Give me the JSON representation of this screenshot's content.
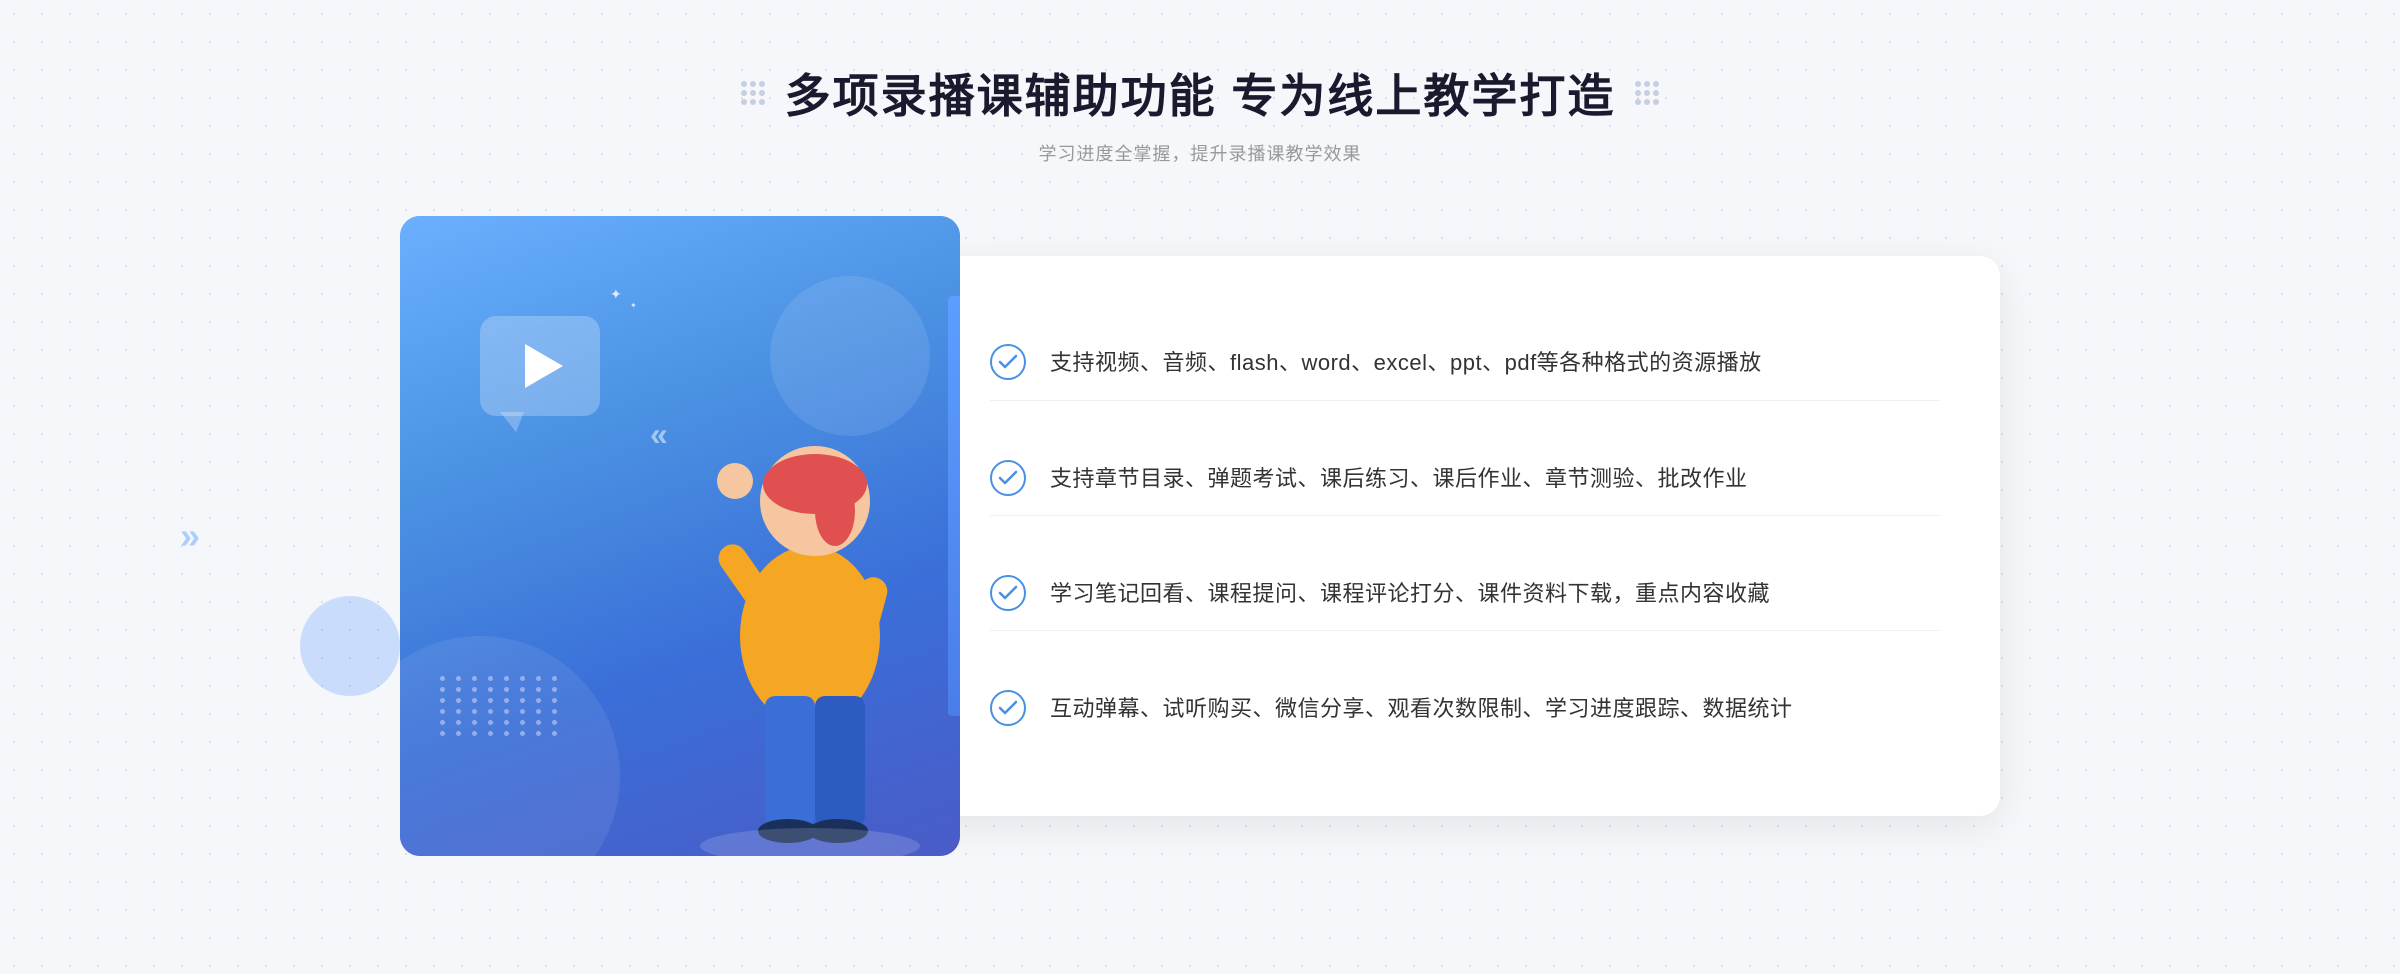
{
  "header": {
    "title": "多项录播课辅助功能 专为线上教学打造",
    "subtitle": "学习进度全掌握，提升录播课教学效果",
    "decor_left_label": "decorative-dots-left",
    "decor_right_label": "decorative-dots-right"
  },
  "features": [
    {
      "id": 1,
      "text": "支持视频、音频、flash、word、excel、ppt、pdf等各种格式的资源播放"
    },
    {
      "id": 2,
      "text": "支持章节目录、弹题考试、课后练习、课后作业、章节测验、批改作业"
    },
    {
      "id": 3,
      "text": "学习笔记回看、课程提问、课程评论打分、课件资料下载，重点内容收藏"
    },
    {
      "id": 4,
      "text": "互动弹幕、试听购买、微信分享、观看次数限制、学习进度跟踪、数据统计"
    }
  ],
  "colors": {
    "primary_blue": "#4a90e2",
    "light_blue": "#6ab0ff",
    "dark_blue": "#3a6fd8",
    "text_dark": "#1a1a2e",
    "text_gray": "#999999",
    "text_feature": "#333333"
  }
}
